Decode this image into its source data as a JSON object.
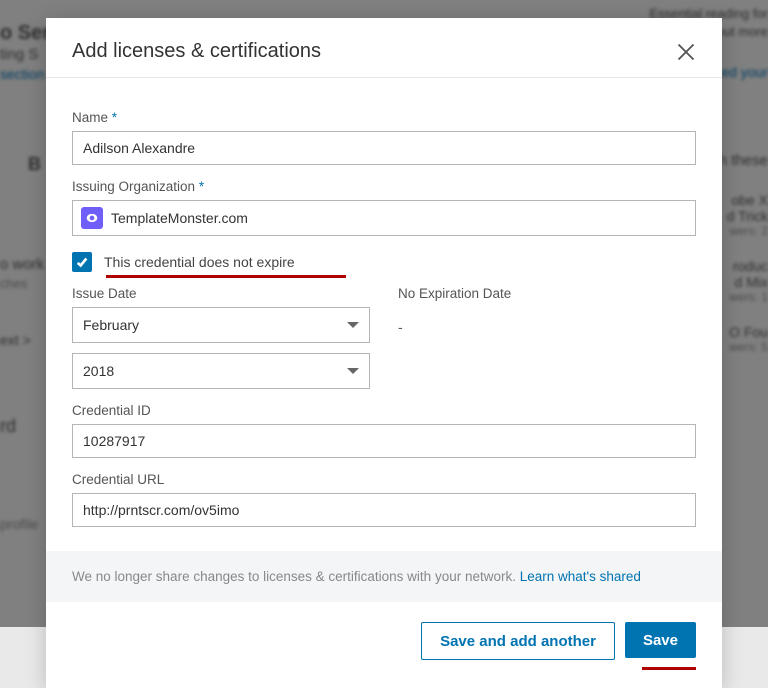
{
  "bg": {
    "t1": "o Ser",
    "t2": "ting S",
    "t3": "section",
    "t4": "B",
    "t5": "o work",
    "t6": "ches",
    "t7": "ext >",
    "t8": "rd",
    "t9": "profile",
    "t10": "Essential reading for",
    "t11": "out more",
    "t12": "ed your",
    "t13": "th these",
    "t14": "obe X",
    "t15": "d Trick",
    "t16": "wers: 2",
    "t17": "roduc",
    "t18": "d Mix",
    "t19": "wers: 1",
    "t20": "O Fou",
    "t21": "wers: 5"
  },
  "modal": {
    "title": "Add licenses & certifications",
    "name_label": "Name",
    "name_value": "Adilson Alexandre",
    "org_label": "Issuing Organization",
    "org_value": "TemplateMonster.com",
    "no_expire": "This credential does not expire",
    "issue_label": "Issue Date",
    "issue_month": "February",
    "issue_year": "2018",
    "exp_label": "No Expiration Date",
    "exp_value": "-",
    "credid_label": "Credential ID",
    "credid_value": "10287917",
    "credurl_label": "Credential URL",
    "credurl_value": "http://prntscr.com/ov5imo",
    "notice_text": "We no longer share changes to licenses & certifications with your network. ",
    "notice_link": "Learn what's shared",
    "btn_add": "Save and add another",
    "btn_save": "Save"
  }
}
